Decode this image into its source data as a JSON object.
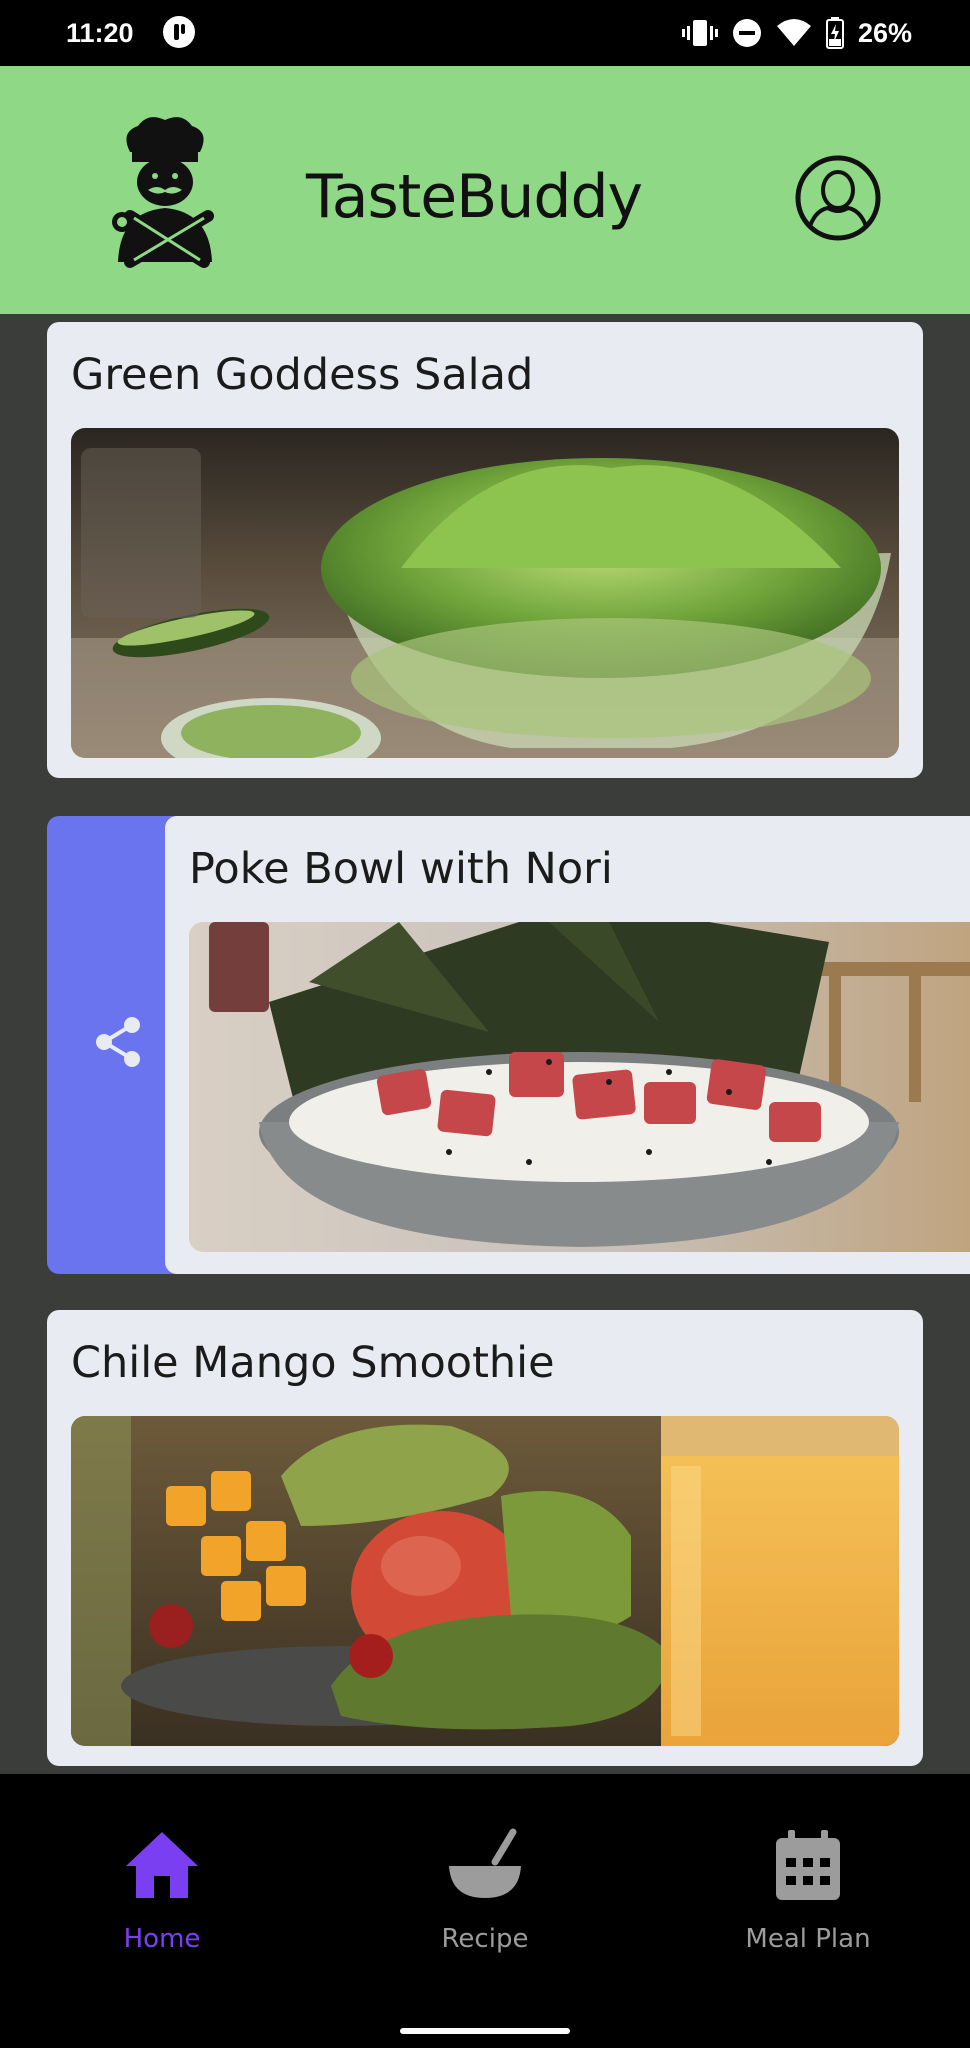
{
  "status_bar": {
    "time": "11:20",
    "battery": "26%",
    "icons": [
      "pocket-icon",
      "vibrate-icon",
      "do-not-disturb-icon",
      "wifi-icon",
      "battery-charging-icon"
    ]
  },
  "header": {
    "title": "TasteBuddy",
    "logo_icon": "chef-logo-icon",
    "profile_icon": "profile-icon",
    "background": "#8fd886"
  },
  "recipes": [
    {
      "title": "Green Goddess Salad",
      "image": "green-goddess-salad-photo"
    },
    {
      "title": "Poke Bowl with Nori",
      "image": "poke-bowl-photo",
      "swipe_action": "share-icon"
    },
    {
      "title": "Chile Mango Smoothie",
      "image": "chile-mango-smoothie-photo"
    }
  ],
  "bottom_nav": [
    {
      "label": "Home",
      "icon": "home-icon",
      "active": true
    },
    {
      "label": "Recipe",
      "icon": "bowl-icon",
      "active": false
    },
    {
      "label": "Meal Plan",
      "icon": "calendar-icon",
      "active": false
    }
  ],
  "colors": {
    "active_nav": "#7b3ff2",
    "inactive_nav": "#9c9c9c",
    "share_action": "#6a74ef",
    "card_bg": "#e8ecf2",
    "page_bg": "#3a3d39"
  }
}
